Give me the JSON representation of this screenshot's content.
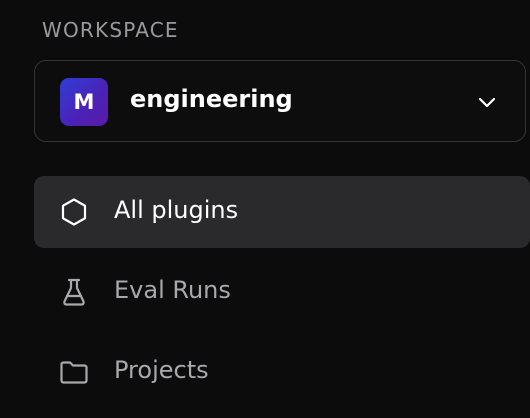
{
  "sidebar": {
    "section_label": "WORKSPACE",
    "workspace": {
      "avatar_letter": "M",
      "name": "engineering",
      "avatar_colors": [
        "#2f3fd6",
        "#5b1aa8"
      ]
    },
    "items": [
      {
        "label": "All plugins",
        "icon": "hexagon-icon",
        "active": true
      },
      {
        "label": "Eval Runs",
        "icon": "flask-icon",
        "active": false
      },
      {
        "label": "Projects",
        "icon": "folder-icon",
        "active": false
      }
    ]
  },
  "colors": {
    "background": "#0c0c0c",
    "active_item_bg": "#2a2a2c",
    "muted_text": "#a9a9ad",
    "border": "#353538"
  }
}
